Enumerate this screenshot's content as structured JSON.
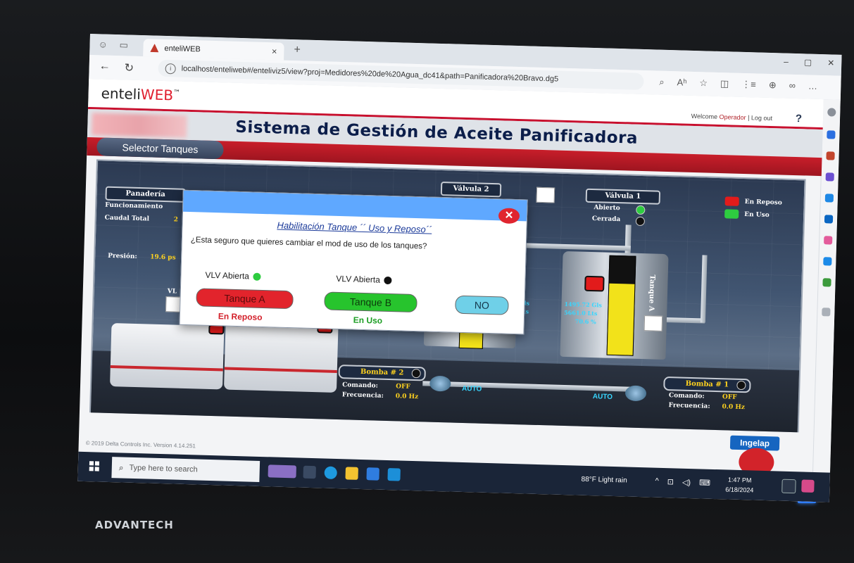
{
  "monitor": {
    "brand": "ADVANTECH"
  },
  "browser": {
    "tab_title": "enteliWEB",
    "tab_close": "×",
    "new_tab": "+",
    "url": "localhost/enteliweb#/enteliviz5/view?proj=Medidores%20de%20Agua_dc41&path=Panificadora%20Bravo.dg5",
    "win_controls": [
      "–",
      "▢",
      "✕"
    ],
    "tools": [
      "⌕",
      "Aʰ",
      "☆",
      "◫",
      "⋮≡",
      "⊕",
      "∞",
      "…"
    ]
  },
  "app": {
    "logo_prefix": "enteli",
    "logo_suffix": "WEB",
    "logo_tm": "™",
    "welcome_text": "Welcome",
    "welcome_user": "Operador",
    "separator": "|",
    "logout": "Log out",
    "help": "?",
    "title": "Sistema de Gestión de Aceite Panificadora",
    "selector_button": "Selector Tanques",
    "copyright": "© 2019 Delta Controls Inc. Version 4.14.251"
  },
  "scada": {
    "panaderia_label": "Panadería",
    "funcionamiento_label": "Funcionamiento",
    "caudal_label": "Caudal Total",
    "caudal_value": "2",
    "presion_label": "Presión:",
    "presion_value": "19.6 ps",
    "vlv_label": "VL",
    "valvula2_label": "Válvula 2",
    "valvula1_label": "Válvula 1",
    "abierto_label": "Abierto",
    "cerrada_label": "Cerrada",
    "legend_reposo": "En Reposo",
    "legend_uso": "En Uso",
    "tank_a_label": "Tanque A",
    "tank_a_gls": "1495.72 Gls",
    "tank_a_lts": "5661.0 Lts",
    "tank_a_pct": "70.6 %",
    "tank_b_gls": "Gls",
    "tank_b_lts": "Lts",
    "tank_a_level": 0.72,
    "tank_b_level": 0.45,
    "bomba2_label": "Bomba # 2",
    "bomba1_label": "Bomba # 1",
    "comando_label": "Comando:",
    "frecuencia_label": "Frecuencia:",
    "comando2_value": "OFF",
    "frecuencia2_value": "0.0 Hz",
    "comando1_value": "OFF",
    "frecuencia1_value": "0.0 Hz",
    "auto_left": "AUTO",
    "auto_right": "AUTO",
    "ingelap": "Ingelap"
  },
  "dialog": {
    "close_label": "✕",
    "title": "Habilitación Tanque ´´ Uso y Reposo´´",
    "question": "¿Esta seguro que quieres cambiar el mod de uso de los tanques?",
    "vlv_a_label": "VLV Abierta",
    "vlv_b_label": "VLV Abierta",
    "tank_a_button": "Tanque A",
    "tank_b_button": "Tanque B",
    "no_button": "NO",
    "tank_a_state": "En Reposo",
    "tank_b_state": "En Uso"
  },
  "taskbar": {
    "search_placeholder": "Type here to search",
    "weather": "88°F  Light rain",
    "time": "1:47 PM",
    "date": "6/18/2024"
  },
  "colors": {
    "accent_red": "#c8102e",
    "status_reposo": "#e21b1b",
    "status_uso": "#2ecc40",
    "dialog_header": "#5fa8ff"
  }
}
